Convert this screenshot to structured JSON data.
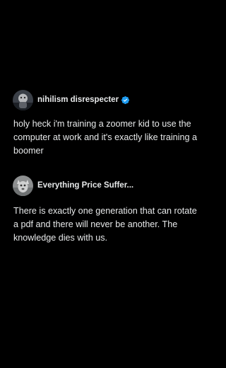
{
  "posts": [
    {
      "author": "nihilism disrespecter",
      "verified": true,
      "avatar_icon": "user-avatar",
      "text": "holy heck i'm training a zoomer kid to use the computer at work and it's exactly like training a boomer"
    },
    {
      "author": "Everything Price Suffer...",
      "verified": false,
      "avatar_icon": "user-avatar",
      "text": "There is exactly one generation that can rotate a pdf and there will never be another. The knowledge dies with us."
    }
  ],
  "colors": {
    "background": "#000000",
    "text": "#e7e9ea",
    "verified_badge": "#1d9bf0"
  }
}
